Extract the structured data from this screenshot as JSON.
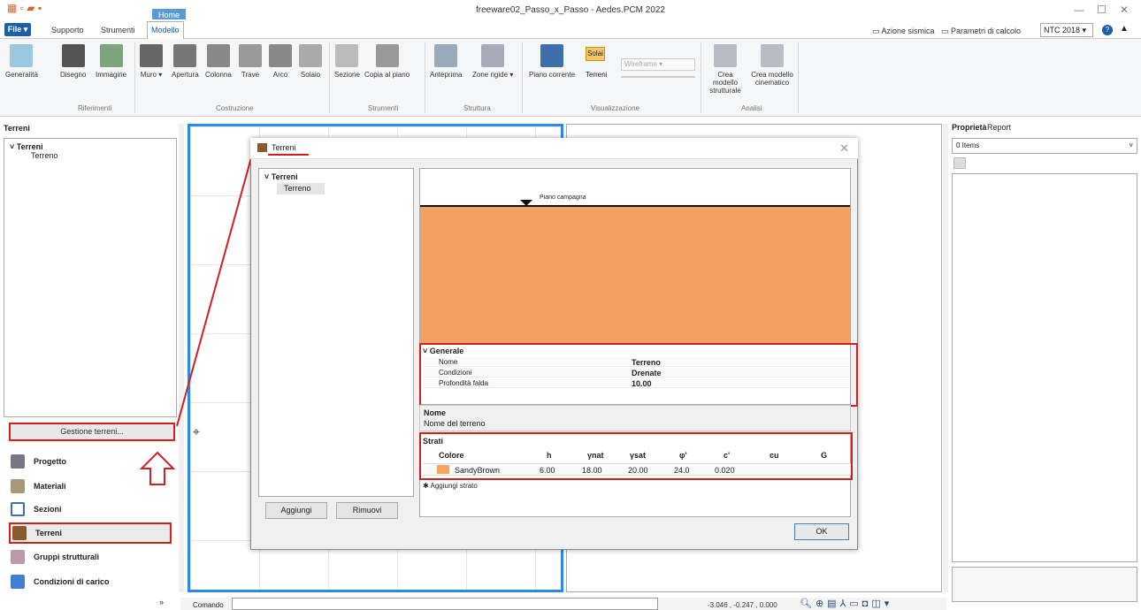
{
  "window": {
    "title": "freeware02_Passo_x_Passo - Aedes.PCM 2022",
    "context_tab": "Home",
    "minimize": "—",
    "maximize": "☐",
    "close": "✕"
  },
  "menu": {
    "file": "File ▾",
    "tabs": [
      "Supporto",
      "Strumenti",
      "Modello"
    ]
  },
  "ribbon_right": {
    "azione": "Azione sismica",
    "parametri": "Parametri di calcolo",
    "norma": "NTC 2018"
  },
  "ribbon": {
    "buttons": [
      "Generalità",
      "Disegno",
      "Immagine",
      "Muro ▾",
      "Apertura",
      "Colonna",
      "Trave",
      "Arco",
      "Solaio",
      "Sezione",
      "Copia al piano",
      "Anteprima",
      "Zone rigide ▾",
      "Piano corrente",
      "Terreni",
      "Crea modello strutturale",
      "Crea modello cinematico"
    ],
    "solai": "Solai",
    "wireframe": "Wireframe",
    "groups": [
      "Riferimenti",
      "Costruzione",
      "Strumenti",
      "Struttura",
      "Visualizzazione",
      "Analisi"
    ]
  },
  "left": {
    "title": "Terreni",
    "tree_root": "Terreni",
    "tree_child": "Terreno",
    "gestione": "Gestione terreni...",
    "nav": [
      "Progetto",
      "Materiali",
      "Sezioni",
      "Terreni",
      "Gruppi strutturali",
      "Condizioni di carico"
    ]
  },
  "dialog": {
    "title": "Terreni",
    "tree_root": "Terreni",
    "tree_child": "Terreno",
    "aggiungi": "Aggiungi",
    "rimuovi": "Rimuovi",
    "piano": "Piano campagna",
    "generale": {
      "header": "Generale",
      "rows": [
        {
          "k": "Nome",
          "v": "Terreno"
        },
        {
          "k": "Condizioni",
          "v": "Drenate"
        },
        {
          "k": "Profondità falda",
          "v": "10.00"
        }
      ]
    },
    "desc_title": "Nome",
    "desc_text": "Nome del terreno",
    "strati": {
      "header": "Strati",
      "cols": [
        "Colore",
        "h",
        "γnat",
        "γsat",
        "φ'",
        "c'",
        "cu",
        "G"
      ],
      "row": {
        "colore": "SandyBrown",
        "h": "6.00",
        "gnat": "18.00",
        "gsat": "20.00",
        "phi": "24.0",
        "c": "0.020"
      },
      "add": "Aggiungi strato"
    },
    "ok": "OK",
    "soil_color": "#f4a460"
  },
  "right": {
    "tab1": "Proprietà",
    "tab2": "Report",
    "items": "0 Items"
  },
  "status": {
    "cmd": "Comando",
    "coords": "-3.046 , -0.247 , 0.000"
  }
}
